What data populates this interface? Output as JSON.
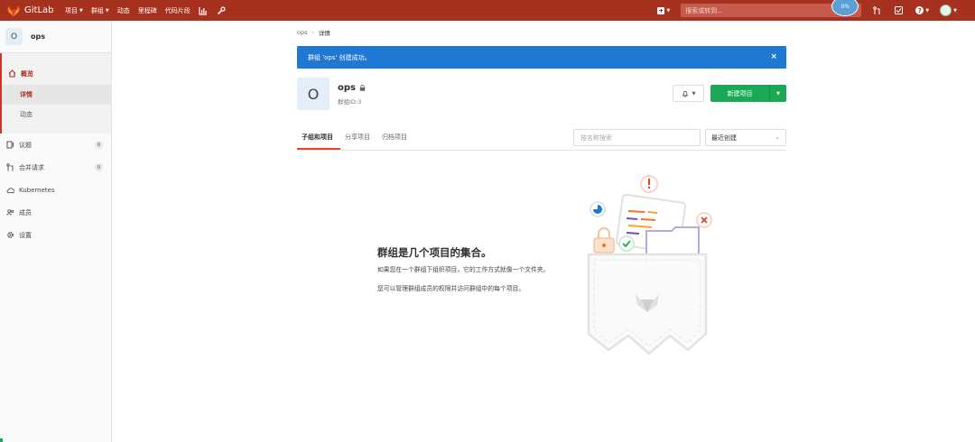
{
  "navbar": {
    "brand": "GitLab",
    "links": [
      {
        "label": "项目",
        "has_caret": true
      },
      {
        "label": "群组",
        "has_caret": true
      },
      {
        "label": "动态",
        "has_caret": false
      },
      {
        "label": "里程碑",
        "has_caret": false
      },
      {
        "label": "代码片段",
        "has_caret": false
      }
    ],
    "search_placeholder": "搜索或转到...",
    "floating_badge": "0%"
  },
  "sidebar": {
    "context_avatar": "O",
    "context_name": "ops",
    "overview_label": "概览",
    "overview_sub": [
      "详情",
      "动态"
    ],
    "items": [
      {
        "label": "议题",
        "count": "0"
      },
      {
        "label": "合并请求",
        "count": "0"
      },
      {
        "label": "Kubernetes",
        "count": null
      },
      {
        "label": "成员",
        "count": null
      },
      {
        "label": "设置",
        "count": null
      }
    ]
  },
  "breadcrumb": {
    "parent": "ops",
    "current": "详情"
  },
  "flash": {
    "message": "群组 'ops' 创建成功。"
  },
  "group": {
    "avatar": "O",
    "name": "ops",
    "id_text": "群组ID:3",
    "new_project_label": "新建项目"
  },
  "tabs": [
    "子组和项目",
    "分享项目",
    "归档项目"
  ],
  "filter": {
    "placeholder": "按名称搜索",
    "sort_selected": "最近创建"
  },
  "empty_state": {
    "title": "群组是几个项目的集合。",
    "line1": "如果您在一个群组下组织项目，它的工作方式就像一个文件夹。",
    "line2": "您可以管理群组成员的权限并访问群组中的每个项目。"
  },
  "colors": {
    "navbar": "#a7311f",
    "flash": "#1f78d1",
    "primary_button": "#1aaa55",
    "tab_underline": "#e24329"
  }
}
